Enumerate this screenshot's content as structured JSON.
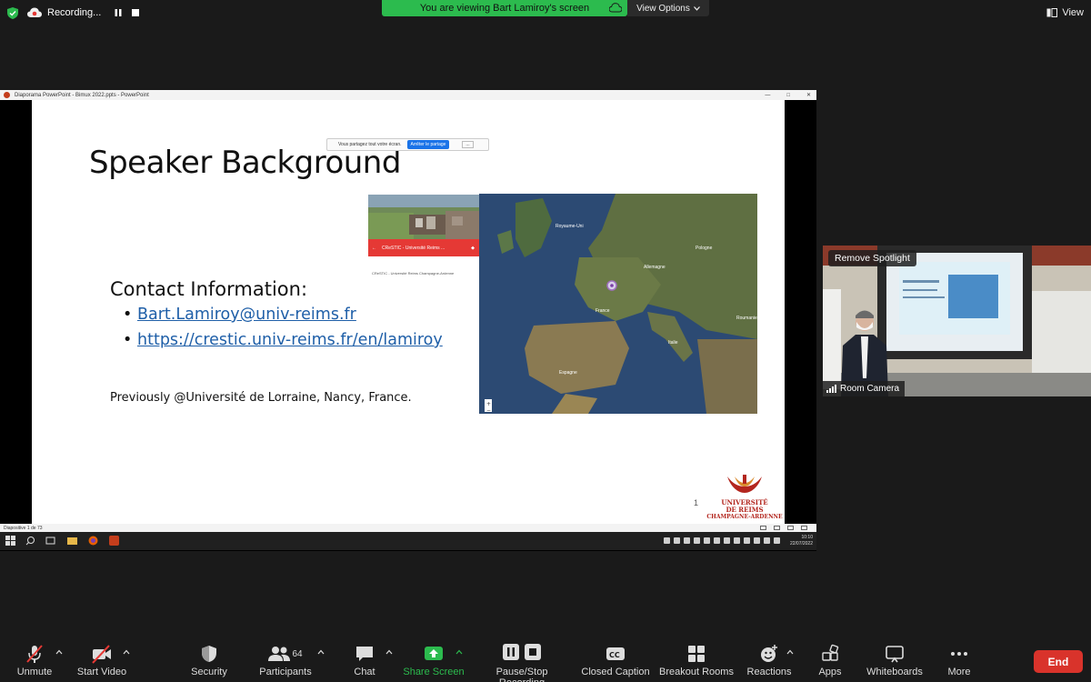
{
  "topbar": {
    "recording_label": "Recording...",
    "viewing_text": "You are viewing Bart Lamiroy's screen",
    "view_options_label": "View Options",
    "view_label": "View"
  },
  "ppt": {
    "window_title": "Diaporama PowerPoint - Bimux 2022.ppts - PowerPoint",
    "status_text": "Diapositive 1 de 73",
    "clock_time": "10:10",
    "clock_date": "22/07/2022"
  },
  "slide": {
    "title": "Speaker Background",
    "share_banner_text": "Vous partagez tout votre écran.",
    "share_banner_stop": "Arrêter le partage",
    "share_banner_hide": "...",
    "photo_bar_text": "CReSTIC - Université Reims ...",
    "photo_caption": "CReSTIC - Université Reims Champagne-Ardenne",
    "contact_heading": "Contact Information:",
    "contact_links": [
      "Bart.Lamiroy@univ-reims.fr",
      "https://crestic.univ-reims.fr/en/lamiroy"
    ],
    "previously": "Previously @Université de Lorraine, Nancy, France.",
    "slide_number": "1",
    "logo_lines": [
      "UNIVERSITÉ",
      "DE REIMS",
      "CHAMPAGNE-ARDENNE"
    ],
    "map_labels": [
      "Royaume-Uni",
      "Allemagne",
      "Pologne",
      "France",
      "Italie",
      "Espagne",
      "Roumanie"
    ]
  },
  "spotlight": {
    "remove_label": "Remove Spotlight",
    "camera_name": "Room Camera"
  },
  "toolbar": {
    "unmute": "Unmute",
    "start_video": "Start Video",
    "security": "Security",
    "participants": "Participants",
    "participants_count": "64",
    "chat": "Chat",
    "share_screen": "Share Screen",
    "pause_stop_recording": "Pause/Stop Recording",
    "closed_caption": "Closed Caption",
    "breakout_rooms": "Breakout Rooms",
    "reactions": "Reactions",
    "apps": "Apps",
    "whiteboards": "Whiteboards",
    "more": "More",
    "end": "End"
  },
  "colors": {
    "accent_green": "#2cbb4e",
    "end_red": "#d9332b",
    "link_blue": "#1f5fa8"
  }
}
